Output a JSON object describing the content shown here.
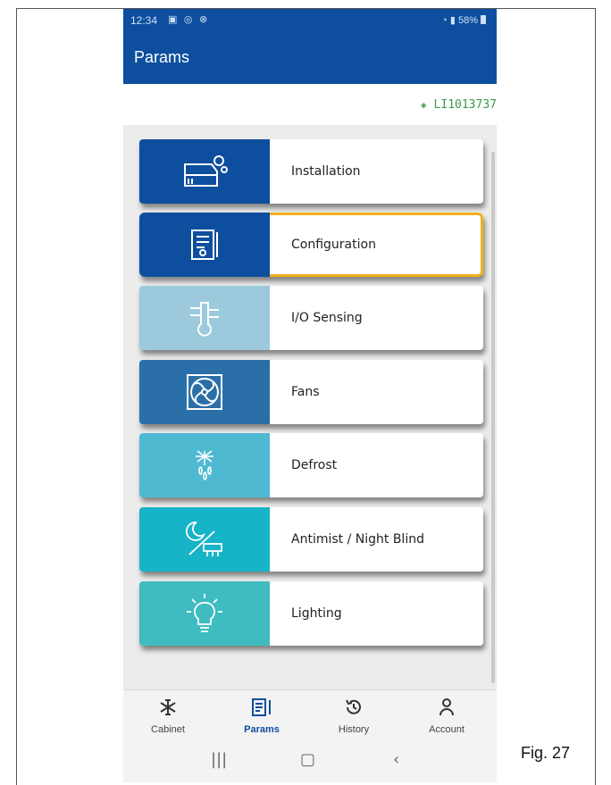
{
  "status_bar": {
    "time": "12:34",
    "battery": "58%"
  },
  "app_bar": {
    "title": "Params"
  },
  "device": {
    "id": "LI1013737"
  },
  "menu": [
    {
      "label": "Installation",
      "icon": "installation-icon",
      "color": "#0d4f9e"
    },
    {
      "label": "Configuration",
      "icon": "configuration-icon",
      "color": "#0d4f9e",
      "selected": true
    },
    {
      "label": "I/O Sensing",
      "icon": "io-sensing-icon",
      "color": "#9cc9dc"
    },
    {
      "label": "Fans",
      "icon": "fan-icon",
      "color": "#2a6fa8"
    },
    {
      "label": "Defrost",
      "icon": "defrost-icon",
      "color": "#4fb9d2"
    },
    {
      "label": "Antimist / Night Blind",
      "icon": "antimist-icon",
      "color": "#17b3c6"
    },
    {
      "label": "Lighting",
      "icon": "lighting-icon",
      "color": "#3fbcbf"
    }
  ],
  "bottom_nav": [
    {
      "label": "Cabinet",
      "icon": "snowflake-icon"
    },
    {
      "label": "Params",
      "icon": "params-icon",
      "active": true
    },
    {
      "label": "History",
      "icon": "history-icon"
    },
    {
      "label": "Account",
      "icon": "account-icon"
    }
  ],
  "caption": "Fig. 27",
  "colors": {
    "primary": "#0d4f9e",
    "highlight": "#f2b11b",
    "device_id": "#3a9a4a"
  }
}
